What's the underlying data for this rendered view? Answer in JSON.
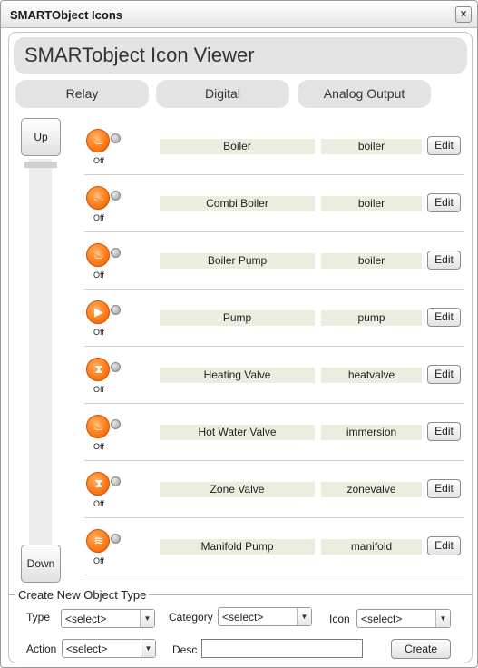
{
  "window": {
    "title": "SMARTObject Icons",
    "close_label": "×"
  },
  "viewer": {
    "title": "SMARTobject Icon Viewer"
  },
  "tabs": [
    {
      "label": "Relay"
    },
    {
      "label": "Digital"
    },
    {
      "label": "Analog Output"
    }
  ],
  "nav": {
    "up_label": "Up",
    "down_label": "Down"
  },
  "icon_color": "#ff7d1a",
  "objects": [
    {
      "name": "Boiler",
      "category": "boiler",
      "status": "Off",
      "icon": "flame-icon",
      "glyph": "♨",
      "edit_label": "Edit"
    },
    {
      "name": "Combi Boiler",
      "category": "boiler",
      "status": "Off",
      "icon": "flame-icon",
      "glyph": "♨",
      "edit_label": "Edit"
    },
    {
      "name": "Boiler Pump",
      "category": "boiler",
      "status": "Off",
      "icon": "flame-icon",
      "glyph": "♨",
      "edit_label": "Edit"
    },
    {
      "name": "Pump",
      "category": "pump",
      "status": "Off",
      "icon": "pump-icon",
      "glyph": "▶",
      "edit_label": "Edit"
    },
    {
      "name": "Heating Valve",
      "category": "heatvalve",
      "status": "Off",
      "icon": "valve-icon",
      "glyph": "⧗",
      "edit_label": "Edit"
    },
    {
      "name": "Hot Water Valve",
      "category": "immersion",
      "status": "Off",
      "icon": "flame-icon",
      "glyph": "♨",
      "edit_label": "Edit"
    },
    {
      "name": "Zone Valve",
      "category": "zonevalve",
      "status": "Off",
      "icon": "valve-icon",
      "glyph": "⧗",
      "edit_label": "Edit"
    },
    {
      "name": "Manifold Pump",
      "category": "manifold",
      "status": "Off",
      "icon": "manifold-icon",
      "glyph": "≋",
      "edit_label": "Edit"
    }
  ],
  "create": {
    "legend": "Create New Object Type",
    "type_label": "Type",
    "type_value": "<select>",
    "category_label": "Category",
    "category_value": "<select>",
    "icon_label": "Icon",
    "icon_value": "<select>",
    "action_label": "Action",
    "action_value": "<select>",
    "desc_label": "Desc",
    "desc_value": "",
    "create_label": "Create"
  }
}
